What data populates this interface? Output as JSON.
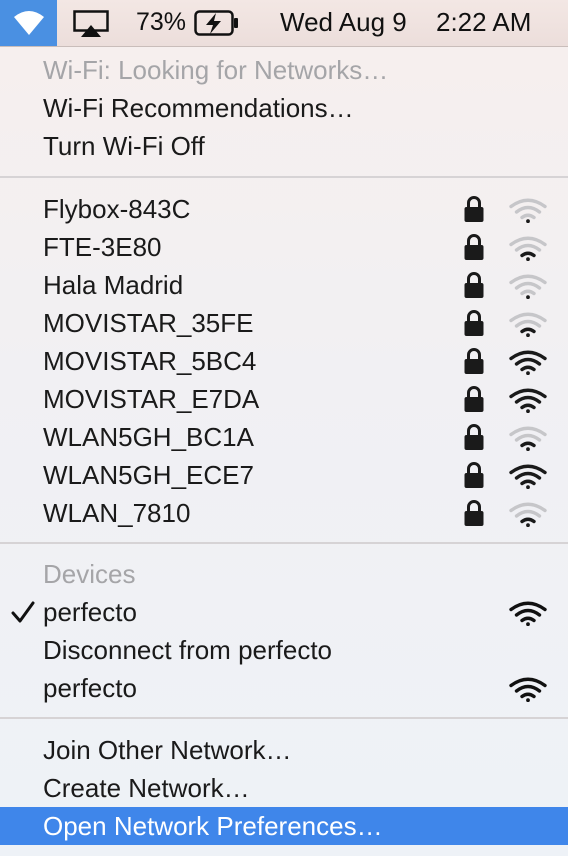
{
  "menubar": {
    "wifi_icon": "wifi-icon",
    "airplay_icon": "airplay-icon",
    "battery_percent": "73%",
    "battery_icon": "battery-charging-icon",
    "date": "Wed Aug 9",
    "time": "2:22 AM"
  },
  "status": {
    "header": "Wi-Fi: Looking for Networks…",
    "recommendations": "Wi-Fi Recommendations…",
    "turn_off": "Turn Wi-Fi Off"
  },
  "networks": [
    {
      "name": "Flybox-843C",
      "locked": true,
      "signal": 0.25
    },
    {
      "name": "FTE-3E80",
      "locked": true,
      "signal": 0.5
    },
    {
      "name": "Hala Madrid",
      "locked": true,
      "signal": 0.25
    },
    {
      "name": "MOVISTAR_35FE",
      "locked": true,
      "signal": 0.5
    },
    {
      "name": "MOVISTAR_5BC4",
      "locked": true,
      "signal": 1.0
    },
    {
      "name": "MOVISTAR_E7DA",
      "locked": true,
      "signal": 1.0
    },
    {
      "name": "WLAN5GH_BC1A",
      "locked": true,
      "signal": 0.5
    },
    {
      "name": "WLAN5GH_ECE7",
      "locked": true,
      "signal": 1.0
    },
    {
      "name": "WLAN_7810",
      "locked": true,
      "signal": 0.5
    }
  ],
  "devices": {
    "header": "Devices",
    "connected": "perfecto",
    "disconnect": "Disconnect from perfecto",
    "other": "perfecto"
  },
  "actions": {
    "join_other": "Join Other Network…",
    "create": "Create Network…",
    "open_prefs": "Open Network Preferences…"
  },
  "colors": {
    "highlight": "#3f86ea",
    "menubar_wifi_bg": "#4a90e2",
    "disabled_text": "#a5a5a8"
  }
}
